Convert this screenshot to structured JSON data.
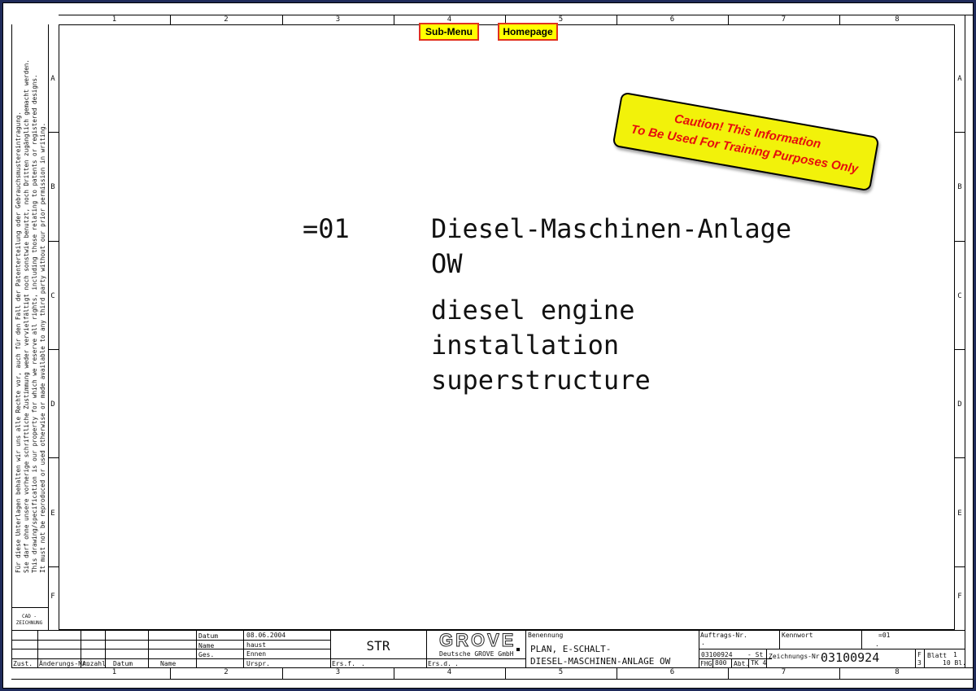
{
  "nav": {
    "submenu_label": "Sub-Menu",
    "homepage_label": "Homepage"
  },
  "caution": {
    "line1": "Caution! This Information",
    "line2": "To Be Used For Training Purposes Only"
  },
  "grid": {
    "columns": [
      "1",
      "2",
      "3",
      "4",
      "5",
      "6",
      "7",
      "8"
    ],
    "rows": [
      "A",
      "B",
      "C",
      "D",
      "E",
      "F"
    ]
  },
  "legal": {
    "line1": "Für diese Unterlagen behalten wir uns alle Rechte vor, auch für den Fall der Patenterteilung oder Gebrauchsmustereintragung.",
    "line2": "Sie darf ohne unsere vorherige schriftliche Zustimmung weder vervielfältigt noch sonstwie benutzt, noch Dritten zugänglich gemacht werden.",
    "line3": "This drawing/specification is our property for which we reserve all rights, including those relating to patents or registered designs.",
    "line4": "It must not be reproduced or used otherwise or made available to any third party without our prior permission in writing."
  },
  "cad_label": "CAD -\nZEICHNUNG",
  "content": {
    "code": "=01",
    "title_de_1": "Diesel-Maschinen-Anlage",
    "title_de_2": "OW",
    "title_en_1": "diesel engine",
    "title_en_2": "installation",
    "title_en_3": "superstructure"
  },
  "titleblock": {
    "zust": "Zust.",
    "aenderungs_nr": "Änderungs-Nr.",
    "anzahl": "Anzahl",
    "datum_col": "Datum",
    "name_col": "Name",
    "datum_label": "Datum",
    "datum_value": "08.06.2004",
    "name_label": "Name",
    "name_value": "haust",
    "ges_label": "Ges.",
    "ges_value": "Ennen",
    "urspr_label": "Urspr.",
    "str": "STR",
    "ers_f": "Ers.f.",
    "ers_f_val": ".",
    "ers_d": "Ers.d.",
    "ers_d_val": ".",
    "grove_logo": "GROVE",
    "company": "Deutsche GROVE GmbH",
    "benennung_label": "Benennung",
    "benennung_1": "PLAN, E-SCHALT-",
    "benennung_2": "DIESEL-MASCHINEN-ANLAGE OW",
    "auftrags_label": "Auftrags-Nr.",
    "auftrags_val": ".",
    "kennwort_label": "Kennwort",
    "kennwort_val": ".",
    "code_val": "=01",
    "order_no": "03100924",
    "st": "- St",
    "zeichnungs_label": "Zeichnungs-Nr.",
    "zeichnungs_nr": "03100924",
    "fhg_label": "FHG",
    "fhg_val": "800",
    "abt_label": "Abt.",
    "abt_val": "TK 4",
    "f_label": "F",
    "f_val": "3",
    "blatt_label": "Blatt",
    "blatt_val": "1",
    "bl_val": "10 Bl."
  }
}
